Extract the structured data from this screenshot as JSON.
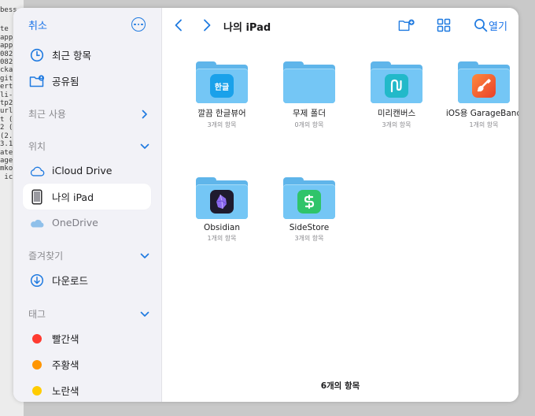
{
  "background": {
    "terminal_lines": [
      "bess",
      "",
      "te",
      "app",
      "app",
      "082",
      "082",
      "cka",
      "git",
      "ert",
      "li-",
      "tp2",
      "url",
      "t (",
      "2 (",
      "(2.",
      "3.1",
      "ate",
      "age",
      "mko",
      " ic"
    ]
  },
  "sidebar": {
    "cancel_label": "취소",
    "more_icon": "ellipsis-circle-icon",
    "top_items": [
      {
        "label": "최근 항목",
        "icon": "clock-icon"
      },
      {
        "label": "공유됨",
        "icon": "shared-folder-icon"
      }
    ],
    "recent_used_label": "최근 사용",
    "location_label": "위치",
    "locations": [
      {
        "label": "iCloud Drive",
        "icon": "cloud-icon"
      },
      {
        "label": "나의 iPad",
        "icon": "ipad-icon",
        "selected": true
      },
      {
        "label": "OneDrive",
        "icon": "onedrive-icon"
      }
    ],
    "favorites_label": "즐겨찾기",
    "favorites": [
      {
        "label": "다운로드",
        "icon": "download-icon"
      }
    ],
    "tags_label": "태그",
    "tags": [
      {
        "label": "빨간색",
        "color": "#ff3b30"
      },
      {
        "label": "주황색",
        "color": "#ff9500"
      },
      {
        "label": "노란색",
        "color": "#ffcc00"
      }
    ]
  },
  "toolbar": {
    "title": "나의 iPad",
    "open_label": "열기",
    "accent": "#1a73e8"
  },
  "files": [
    {
      "name": "깔끔 한글뷰어",
      "meta": "3개의 항목",
      "app_icon": "hangul-icon",
      "app_text": "한글"
    },
    {
      "name": "무제 폴더",
      "meta": "0개의 항목",
      "app_icon": "",
      "app_text": ""
    },
    {
      "name": "미리캔버스",
      "meta": "3개의 항목",
      "app_icon": "miricanvas-icon",
      "app_text": ""
    },
    {
      "name": "iOS용 GarageBand",
      "meta": "1개의 항목",
      "app_icon": "garageband-icon",
      "app_text": ""
    },
    {
      "name": "Obsidian",
      "meta": "1개의 항목",
      "app_icon": "obsidian-icon",
      "app_text": ""
    },
    {
      "name": "SideStore",
      "meta": "3개의 항목",
      "app_icon": "sidestore-icon",
      "app_text": ""
    }
  ],
  "footer": {
    "item_count": "6개의 항목"
  }
}
